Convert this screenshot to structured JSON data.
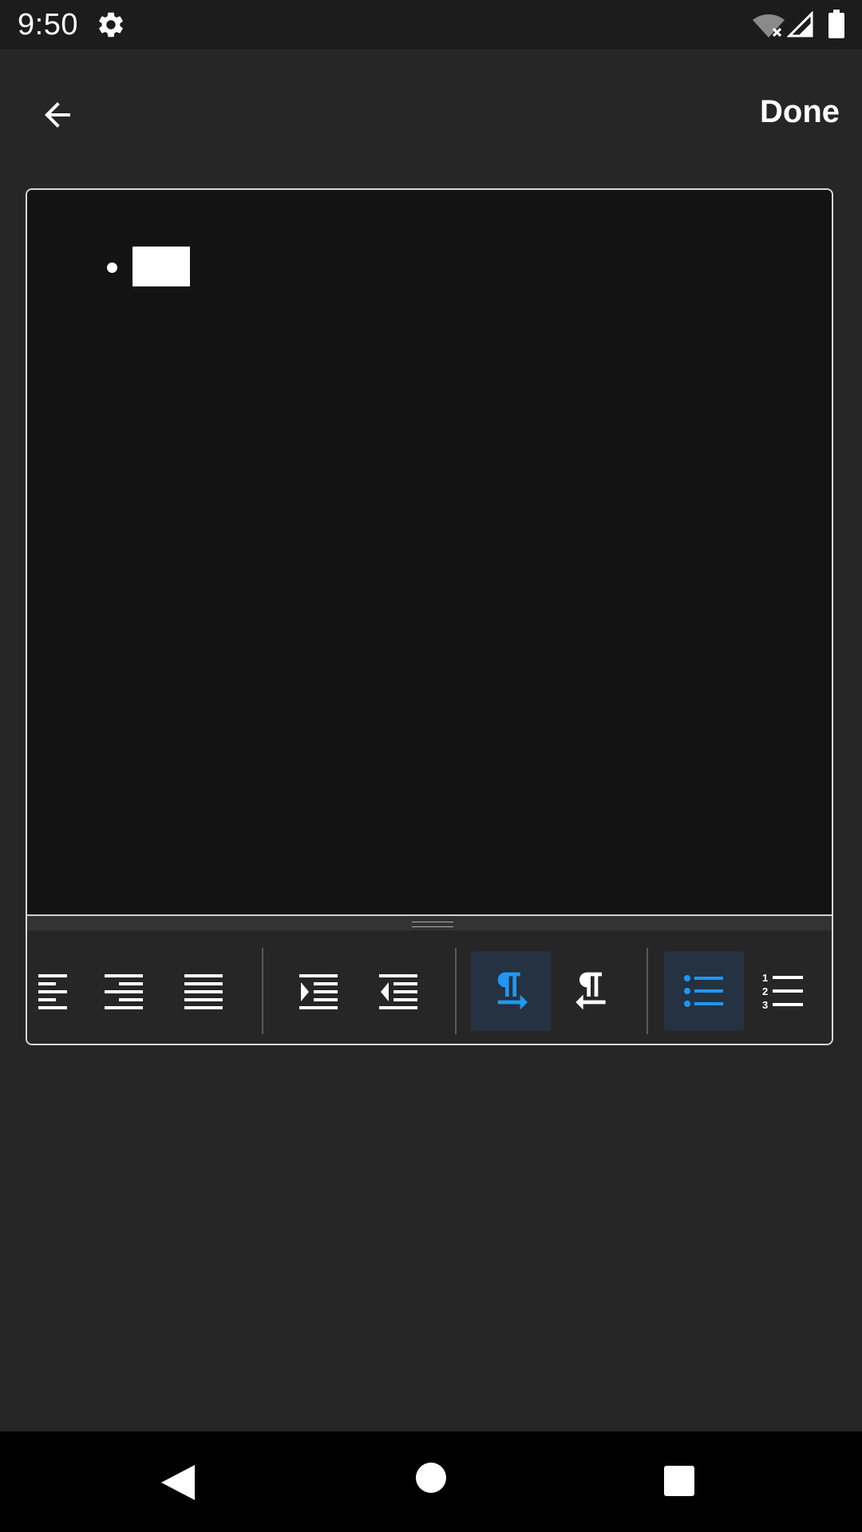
{
  "status_bar": {
    "time": "9:50",
    "icons": [
      "gear-icon",
      "wifi-off-icon",
      "cell-signal-icon",
      "battery-icon"
    ]
  },
  "app_bar": {
    "back_icon": "arrow-left-icon",
    "done_label": "Done"
  },
  "editor": {
    "list_style": "bullet",
    "toolbar": {
      "groups": [
        [
          "align-left-icon",
          "align-right-icon",
          "align-justify-icon"
        ],
        [
          "indent-increase-icon",
          "indent-decrease-icon"
        ],
        [
          "ltr-paragraph-icon",
          "rtl-paragraph-icon"
        ],
        [
          "bulleted-list-icon",
          "numbered-list-icon"
        ]
      ],
      "active": [
        "ltr-paragraph-icon",
        "bulleted-list-icon"
      ],
      "active_color": "#2196f3",
      "active_bg": "#243241"
    }
  },
  "colors": {
    "background": "#262626",
    "editor_bg": "#131313",
    "status_bar_bg": "#1c1c1c",
    "nav_bar_bg": "#000000"
  },
  "nav_bar": {
    "icons": [
      "nav-back-icon",
      "nav-home-icon",
      "nav-recents-icon"
    ]
  }
}
